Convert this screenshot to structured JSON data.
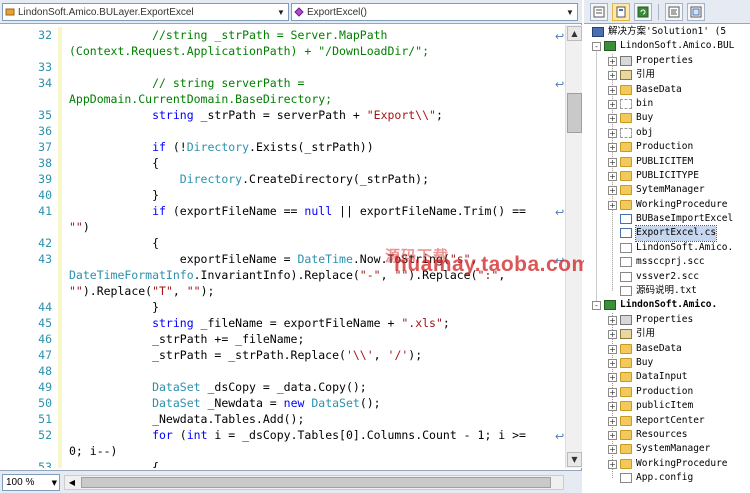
{
  "navbar": {
    "left_combo": "LindonSoft.Amico.BULayer.ExportExcel",
    "right_combo": "ExportExcel()"
  },
  "editor": {
    "lines": [
      {
        "num": "32",
        "tokens": [
          {
            "t": "cmt",
            "v": "            //string _strPath = Server.MapPath"
          }
        ],
        "wrap": true
      },
      {
        "num": "",
        "tokens": [
          {
            "t": "cmt",
            "v": "(Context.Request.ApplicationPath) + \"/DownLoadDir/\";"
          }
        ]
      },
      {
        "num": "33",
        "tokens": []
      },
      {
        "num": "34",
        "tokens": [
          {
            "t": "cmt",
            "v": "            // string serverPath ="
          }
        ],
        "wrap": true
      },
      {
        "num": "",
        "tokens": [
          {
            "t": "cmt",
            "v": "AppDomain.CurrentDomain.BaseDirectory;"
          }
        ]
      },
      {
        "num": "35",
        "tokens": [
          {
            "t": "kw",
            "v": "            string"
          },
          {
            "t": "plain",
            "v": " _strPath = serverPath + "
          },
          {
            "t": "str",
            "v": "\"Export\\\\\""
          },
          {
            "t": "plain",
            "v": ";"
          }
        ]
      },
      {
        "num": "36",
        "tokens": []
      },
      {
        "num": "37",
        "tokens": [
          {
            "t": "kw",
            "v": "            if"
          },
          {
            "t": "plain",
            "v": " (!"
          },
          {
            "t": "type",
            "v": "Directory"
          },
          {
            "t": "plain",
            "v": ".Exists(_strPath))"
          }
        ]
      },
      {
        "num": "38",
        "tokens": [
          {
            "t": "plain",
            "v": "            {"
          }
        ]
      },
      {
        "num": "39",
        "tokens": [
          {
            "t": "type",
            "v": "                Directory"
          },
          {
            "t": "plain",
            "v": ".CreateDirectory(_strPath);"
          }
        ]
      },
      {
        "num": "40",
        "tokens": [
          {
            "t": "plain",
            "v": "            }"
          }
        ]
      },
      {
        "num": "41",
        "tokens": [
          {
            "t": "kw",
            "v": "            if"
          },
          {
            "t": "plain",
            "v": " (exportFileName == "
          },
          {
            "t": "kw",
            "v": "null"
          },
          {
            "t": "plain",
            "v": " || exportFileName.Trim() =="
          }
        ],
        "wrap": true
      },
      {
        "num": "",
        "tokens": [
          {
            "t": "str",
            "v": "\"\""
          },
          {
            "t": "plain",
            "v": ")"
          }
        ]
      },
      {
        "num": "42",
        "tokens": [
          {
            "t": "plain",
            "v": "            {"
          }
        ]
      },
      {
        "num": "43",
        "tokens": [
          {
            "t": "plain",
            "v": "                exportFileName = "
          },
          {
            "t": "type",
            "v": "DateTime"
          },
          {
            "t": "plain",
            "v": ".Now.ToString("
          },
          {
            "t": "str",
            "v": "\"s\""
          },
          {
            "t": "plain",
            "v": ","
          }
        ],
        "wrap": true
      },
      {
        "num": "",
        "tokens": [
          {
            "t": "type",
            "v": "DateTimeFormatInfo"
          },
          {
            "t": "plain",
            "v": ".InvariantInfo).Replace("
          },
          {
            "t": "str",
            "v": "\"-\""
          },
          {
            "t": "plain",
            "v": ", "
          },
          {
            "t": "str",
            "v": "\"\""
          },
          {
            "t": "plain",
            "v": ").Replace("
          },
          {
            "t": "str",
            "v": "\":\""
          },
          {
            "t": "plain",
            "v": ","
          }
        ]
      },
      {
        "num": "",
        "tokens": [
          {
            "t": "str",
            "v": "\"\""
          },
          {
            "t": "plain",
            "v": ").Replace("
          },
          {
            "t": "str",
            "v": "\"T\""
          },
          {
            "t": "plain",
            "v": ", "
          },
          {
            "t": "str",
            "v": "\"\""
          },
          {
            "t": "plain",
            "v": ");"
          }
        ]
      },
      {
        "num": "44",
        "tokens": [
          {
            "t": "plain",
            "v": "            }"
          }
        ]
      },
      {
        "num": "45",
        "tokens": [
          {
            "t": "kw",
            "v": "            string"
          },
          {
            "t": "plain",
            "v": " _fileName = exportFileName + "
          },
          {
            "t": "str",
            "v": "\".xls\""
          },
          {
            "t": "plain",
            "v": ";"
          }
        ]
      },
      {
        "num": "46",
        "tokens": [
          {
            "t": "plain",
            "v": "            _strPath += _fileName;"
          }
        ]
      },
      {
        "num": "47",
        "tokens": [
          {
            "t": "plain",
            "v": "            _strPath = _strPath.Replace("
          },
          {
            "t": "str",
            "v": "'\\\\'"
          },
          {
            "t": "plain",
            "v": ", "
          },
          {
            "t": "str",
            "v": "'/'"
          },
          {
            "t": "plain",
            "v": ");"
          }
        ]
      },
      {
        "num": "48",
        "tokens": []
      },
      {
        "num": "49",
        "tokens": [
          {
            "t": "type",
            "v": "            DataSet"
          },
          {
            "t": "plain",
            "v": " _dsCopy = _data.Copy();"
          }
        ]
      },
      {
        "num": "50",
        "tokens": [
          {
            "t": "type",
            "v": "            DataSet"
          },
          {
            "t": "plain",
            "v": " _Newdata = "
          },
          {
            "t": "kw",
            "v": "new"
          },
          {
            "t": "type",
            "v": " DataSet"
          },
          {
            "t": "plain",
            "v": "();"
          }
        ]
      },
      {
        "num": "51",
        "tokens": [
          {
            "t": "plain",
            "v": "            _Newdata.Tables.Add();"
          }
        ]
      },
      {
        "num": "52",
        "tokens": [
          {
            "t": "kw",
            "v": "            for"
          },
          {
            "t": "plain",
            "v": " ("
          },
          {
            "t": "kw",
            "v": "int"
          },
          {
            "t": "plain",
            "v": " i = _dsCopy.Tables[0].Columns.Count - 1; i >="
          }
        ],
        "wrap": true
      },
      {
        "num": "",
        "tokens": [
          {
            "t": "plain",
            "v": "0; i--)"
          }
        ]
      },
      {
        "num": "53",
        "tokens": [
          {
            "t": "plain",
            "v": "            {"
          }
        ]
      }
    ]
  },
  "statusbar": {
    "zoom": "100 %"
  },
  "watermark": {
    "cn": "源码下载",
    "url": "huamay.taoba.com"
  },
  "explorer": {
    "rows": [
      {
        "level": 0,
        "exp": "",
        "icon": "sln",
        "label": "解决方案'Solution1' (5"
      },
      {
        "level": 1,
        "exp": "-",
        "icon": "proj",
        "label": "LindonSoft.Amico.BUL"
      },
      {
        "level": 2,
        "exp": "+",
        "icon": "props",
        "label": "Properties"
      },
      {
        "level": 2,
        "exp": "+",
        "icon": "ref",
        "label": "引用"
      },
      {
        "level": 2,
        "exp": "+",
        "icon": "folder",
        "label": "BaseData"
      },
      {
        "level": 2,
        "exp": "+",
        "icon": "folder-empty",
        "label": "bin"
      },
      {
        "level": 2,
        "exp": "+",
        "icon": "folder",
        "label": "Buy"
      },
      {
        "level": 2,
        "exp": "+",
        "icon": "folder-empty",
        "label": "obj"
      },
      {
        "level": 2,
        "exp": "+",
        "icon": "folder",
        "label": "Production"
      },
      {
        "level": 2,
        "exp": "+",
        "icon": "folder",
        "label": "PUBLICITEM"
      },
      {
        "level": 2,
        "exp": "+",
        "icon": "folder",
        "label": "PUBLICITYPE"
      },
      {
        "level": 2,
        "exp": "+",
        "icon": "folder",
        "label": "SytemManager"
      },
      {
        "level": 2,
        "exp": "+",
        "icon": "folder",
        "label": "WorkingProcedure"
      },
      {
        "level": 2,
        "exp": "",
        "icon": "cs",
        "label": "BUBaseImportExcel"
      },
      {
        "level": 2,
        "exp": "",
        "icon": "cs",
        "label": "ExportExcel.cs",
        "selected": true
      },
      {
        "level": 2,
        "exp": "",
        "icon": "file",
        "label": "LindonSoft.Amico."
      },
      {
        "level": 2,
        "exp": "",
        "icon": "file",
        "label": "mssccprj.scc"
      },
      {
        "level": 2,
        "exp": "",
        "icon": "file",
        "label": "vssver2.scc"
      },
      {
        "level": 2,
        "exp": "",
        "icon": "file",
        "label": "源码说明.txt"
      },
      {
        "level": 1,
        "exp": "-",
        "icon": "proj",
        "label": "LindonSoft.Amico.",
        "bold": true
      },
      {
        "level": 2,
        "exp": "+",
        "icon": "props",
        "label": "Properties"
      },
      {
        "level": 2,
        "exp": "+",
        "icon": "ref",
        "label": "引用"
      },
      {
        "level": 2,
        "exp": "+",
        "icon": "folder",
        "label": "BaseData"
      },
      {
        "level": 2,
        "exp": "+",
        "icon": "folder",
        "label": "Buy"
      },
      {
        "level": 2,
        "exp": "+",
        "icon": "folder",
        "label": "DataInput"
      },
      {
        "level": 2,
        "exp": "+",
        "icon": "folder",
        "label": "Production"
      },
      {
        "level": 2,
        "exp": "+",
        "icon": "folder",
        "label": "publicItem"
      },
      {
        "level": 2,
        "exp": "+",
        "icon": "folder",
        "label": "ReportCenter"
      },
      {
        "level": 2,
        "exp": "+",
        "icon": "folder",
        "label": "Resources"
      },
      {
        "level": 2,
        "exp": "+",
        "icon": "folder",
        "label": "SystemManager"
      },
      {
        "level": 2,
        "exp": "+",
        "icon": "folder",
        "label": "WorkingProcedure"
      },
      {
        "level": 2,
        "exp": "",
        "icon": "file",
        "label": "App.config"
      }
    ]
  },
  "colors": {
    "keyword": "#0000ff",
    "type": "#2b91af",
    "string": "#a31515",
    "comment": "#008000",
    "line_number": "#2b91af"
  }
}
